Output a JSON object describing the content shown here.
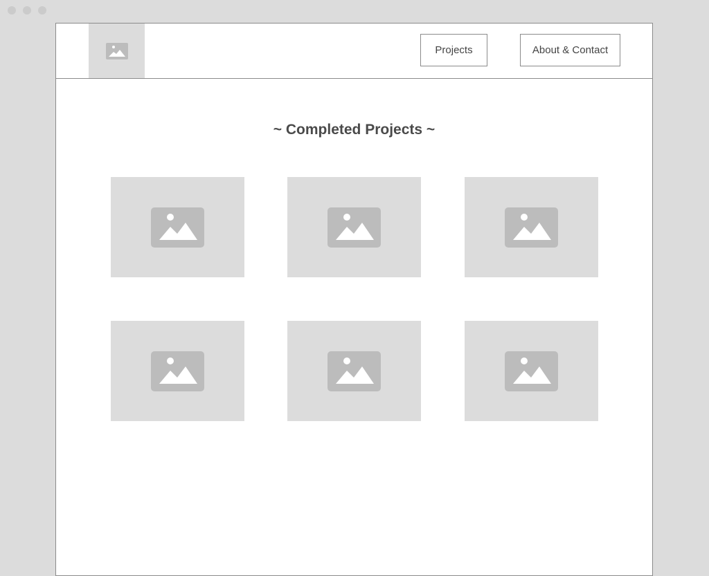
{
  "header": {
    "logo_icon": "image-placeholder-icon",
    "nav": [
      {
        "label": "Projects"
      },
      {
        "label": "About & Contact"
      }
    ]
  },
  "main": {
    "title": "~ Completed Projects ~",
    "tiles": [
      {
        "icon": "image-placeholder-icon"
      },
      {
        "icon": "image-placeholder-icon"
      },
      {
        "icon": "image-placeholder-icon"
      },
      {
        "icon": "image-placeholder-icon"
      },
      {
        "icon": "image-placeholder-icon"
      },
      {
        "icon": "image-placeholder-icon"
      }
    ]
  },
  "colors": {
    "background": "#dcdcdc",
    "placeholder": "#dcdcdc",
    "placeholder_icon": "#bcbcbc",
    "border": "#8a8a8a",
    "text": "#4a4a4a"
  }
}
